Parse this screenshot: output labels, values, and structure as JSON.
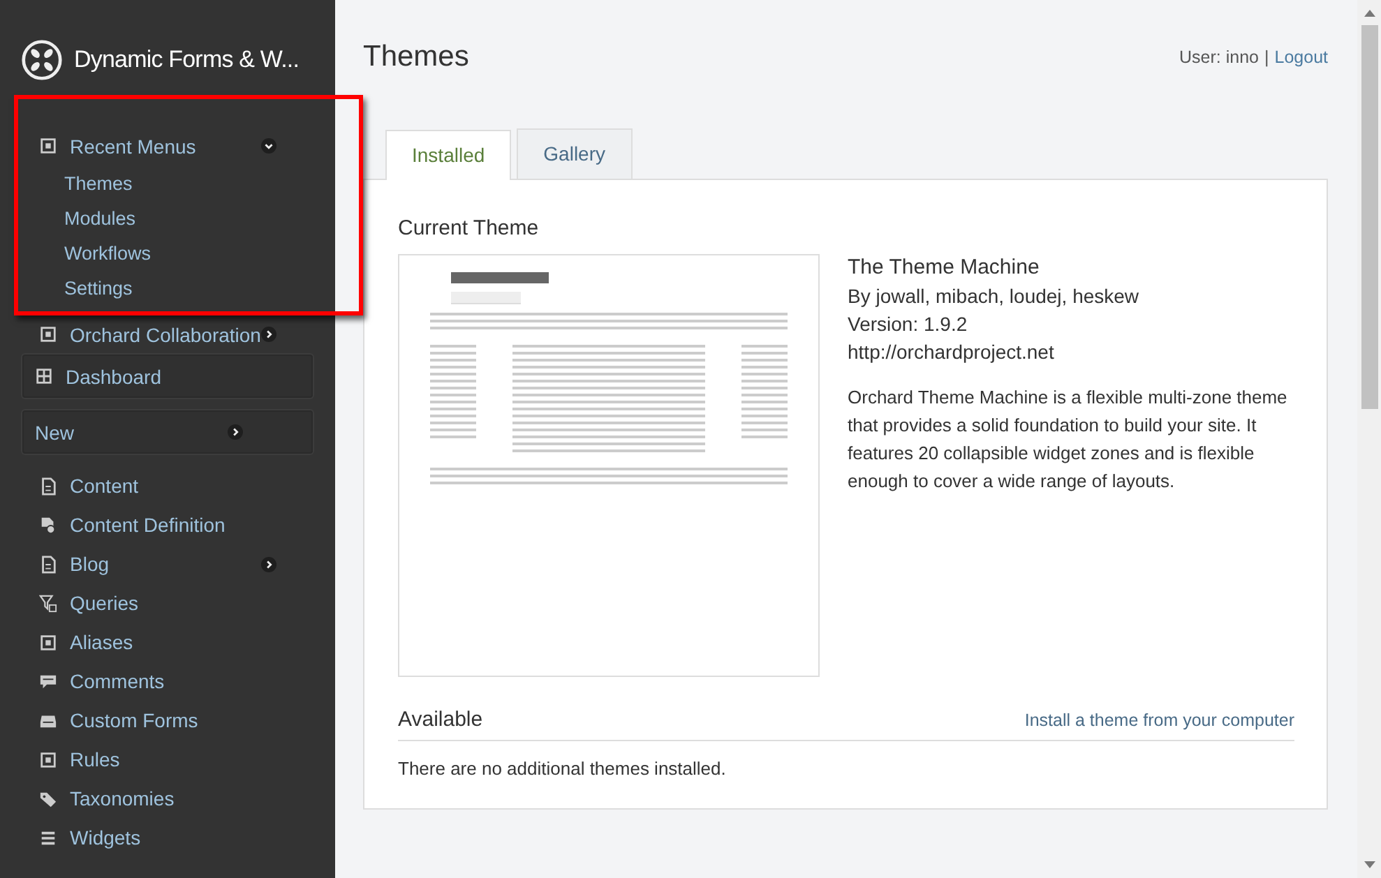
{
  "site": {
    "title": "Dynamic Forms & W..."
  },
  "sidebar": {
    "items": [
      {
        "kind": "section",
        "label": "Recent Menus",
        "expandable": true,
        "expanded": true,
        "children": [
          {
            "label": "Themes"
          },
          {
            "label": "Modules"
          },
          {
            "label": "Workflows"
          },
          {
            "label": "Settings"
          }
        ]
      },
      {
        "kind": "section",
        "label": "Orchard Collaboration",
        "expandable": true,
        "expanded": false
      },
      {
        "kind": "panel",
        "label": "Dashboard",
        "expandable": false
      },
      {
        "kind": "panel",
        "label": "New",
        "expandable": true,
        "expanded": false
      },
      {
        "kind": "link",
        "label": "Content",
        "expandable": false
      },
      {
        "kind": "link",
        "label": "Content Definition",
        "expandable": false
      },
      {
        "kind": "link",
        "label": "Blog",
        "expandable": true,
        "expanded": false
      },
      {
        "kind": "link",
        "label": "Queries",
        "expandable": false
      },
      {
        "kind": "link",
        "label": "Aliases",
        "expandable": false
      },
      {
        "kind": "link",
        "label": "Comments",
        "expandable": false
      },
      {
        "kind": "link",
        "label": "Custom Forms",
        "expandable": false
      },
      {
        "kind": "link",
        "label": "Rules",
        "expandable": false
      },
      {
        "kind": "link",
        "label": "Taxonomies",
        "expandable": false
      },
      {
        "kind": "link",
        "label": "Widgets",
        "expandable": false
      }
    ]
  },
  "page": {
    "title": "Themes",
    "user": "User: inno",
    "separator": "|",
    "logout": "Logout"
  },
  "tabs": [
    {
      "label": "Installed",
      "selected": true
    },
    {
      "label": "Gallery",
      "selected": false
    }
  ],
  "current_theme": {
    "heading": "Current Theme",
    "name": "The Theme Machine",
    "authors": "By jowall, mibach, loudej, heskew",
    "version": "Version: 1.9.2",
    "url": "http://orchardproject.net",
    "description": "Orchard Theme Machine is a flexible multi-zone theme that provides a solid foundation to build your site. It features 20 collapsible widget zones and is flexible enough to cover a wide range of layouts."
  },
  "available": {
    "heading": "Available",
    "install_link": "Install a theme from your computer",
    "message": "There are no additional themes installed."
  }
}
